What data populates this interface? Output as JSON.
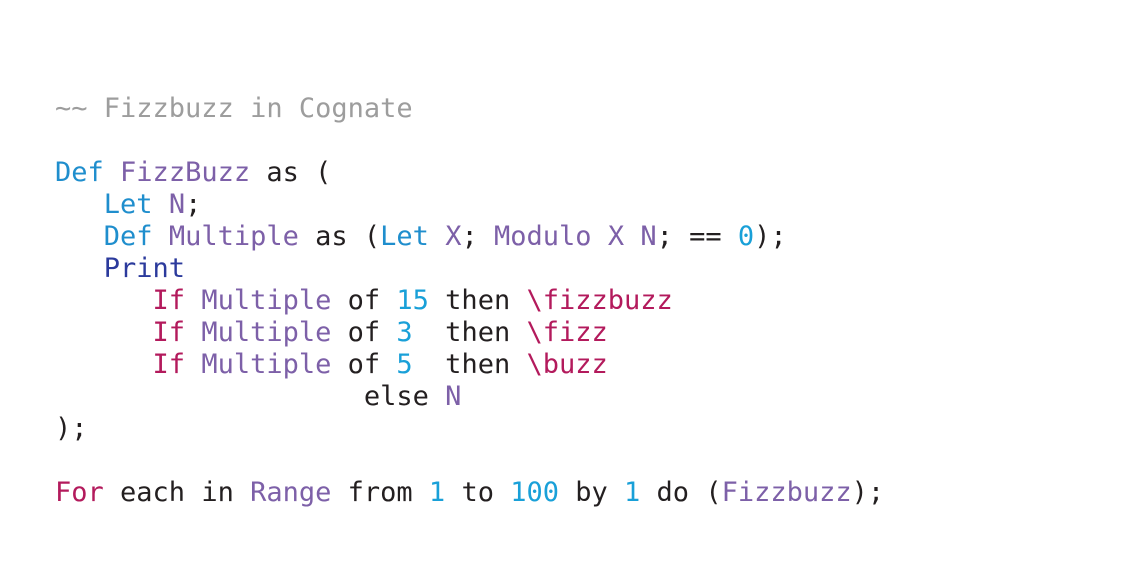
{
  "document": {
    "title": "Fizzbuzz in Cognate",
    "language": "Cognate",
    "background_color": "#ffffff"
  },
  "palette": {
    "comment": "#9d9d9d",
    "definition_keyword": "#1f8ecd",
    "print_keyword": "#2b3a9c",
    "identifier": "#7d60a8",
    "control_keyword": "#b31a5c",
    "number": "#19a0d8",
    "plain": "#231f20",
    "string": "#b31a5c"
  },
  "code": {
    "raw": "~~ Fizzbuzz in Cognate\n\nDef FizzBuzz as (\n   Let N;\n   Def Multiple as (Let X; Modulo X N; == 0);\n   Print\n      If Multiple of 15 then \\fizzbuzz\n      If Multiple of 3  then \\fizz\n      If Multiple of 5  then \\buzz\n                   else N\n);\n\nFor each in Range from 1 to 100 by 1 do (Fizzbuzz);",
    "lines": [
      {
        "id": "line-1-comment",
        "tokens": [
          {
            "text": "~~ Fizzbuzz in Cognate",
            "kind": "comment"
          }
        ]
      },
      {
        "id": "line-2-blank",
        "tokens": []
      },
      {
        "id": "line-3-def-fizzbuzz",
        "tokens": [
          {
            "text": "Def",
            "kind": "definition_keyword"
          },
          {
            "text": " ",
            "kind": "plain"
          },
          {
            "text": "FizzBuzz",
            "kind": "identifier"
          },
          {
            "text": " ",
            "kind": "plain"
          },
          {
            "text": "as",
            "kind": "plain"
          },
          {
            "text": " ",
            "kind": "plain"
          },
          {
            "text": "(",
            "kind": "plain"
          }
        ]
      },
      {
        "id": "line-4-let-n",
        "tokens": [
          {
            "text": "   ",
            "kind": "plain"
          },
          {
            "text": "Let",
            "kind": "definition_keyword"
          },
          {
            "text": " ",
            "kind": "plain"
          },
          {
            "text": "N",
            "kind": "identifier"
          },
          {
            "text": ";",
            "kind": "plain"
          }
        ]
      },
      {
        "id": "line-5-def-multiple",
        "tokens": [
          {
            "text": "   ",
            "kind": "plain"
          },
          {
            "text": "Def",
            "kind": "definition_keyword"
          },
          {
            "text": " ",
            "kind": "plain"
          },
          {
            "text": "Multiple",
            "kind": "identifier"
          },
          {
            "text": " ",
            "kind": "plain"
          },
          {
            "text": "as",
            "kind": "plain"
          },
          {
            "text": " (",
            "kind": "plain"
          },
          {
            "text": "Let",
            "kind": "definition_keyword"
          },
          {
            "text": " ",
            "kind": "plain"
          },
          {
            "text": "X",
            "kind": "identifier"
          },
          {
            "text": "; ",
            "kind": "plain"
          },
          {
            "text": "Modulo",
            "kind": "identifier"
          },
          {
            "text": " ",
            "kind": "plain"
          },
          {
            "text": "X",
            "kind": "identifier"
          },
          {
            "text": " ",
            "kind": "plain"
          },
          {
            "text": "N",
            "kind": "identifier"
          },
          {
            "text": "; == ",
            "kind": "plain"
          },
          {
            "text": "0",
            "kind": "number"
          },
          {
            "text": ");",
            "kind": "plain"
          }
        ]
      },
      {
        "id": "line-6-print",
        "tokens": [
          {
            "text": "   ",
            "kind": "plain"
          },
          {
            "text": "Print",
            "kind": "print_keyword"
          }
        ]
      },
      {
        "id": "line-7-if-15",
        "tokens": [
          {
            "text": "      ",
            "kind": "plain"
          },
          {
            "text": "If",
            "kind": "control_keyword"
          },
          {
            "text": " ",
            "kind": "plain"
          },
          {
            "text": "Multiple",
            "kind": "identifier"
          },
          {
            "text": " of ",
            "kind": "plain"
          },
          {
            "text": "15",
            "kind": "number"
          },
          {
            "text": " then ",
            "kind": "plain"
          },
          {
            "text": "\\fizzbuzz",
            "kind": "string"
          }
        ]
      },
      {
        "id": "line-8-if-3",
        "tokens": [
          {
            "text": "      ",
            "kind": "plain"
          },
          {
            "text": "If",
            "kind": "control_keyword"
          },
          {
            "text": " ",
            "kind": "plain"
          },
          {
            "text": "Multiple",
            "kind": "identifier"
          },
          {
            "text": " of ",
            "kind": "plain"
          },
          {
            "text": "3",
            "kind": "number"
          },
          {
            "text": "  then ",
            "kind": "plain"
          },
          {
            "text": "\\fizz",
            "kind": "string"
          }
        ]
      },
      {
        "id": "line-9-if-5",
        "tokens": [
          {
            "text": "      ",
            "kind": "plain"
          },
          {
            "text": "If",
            "kind": "control_keyword"
          },
          {
            "text": " ",
            "kind": "plain"
          },
          {
            "text": "Multiple",
            "kind": "identifier"
          },
          {
            "text": " of ",
            "kind": "plain"
          },
          {
            "text": "5",
            "kind": "number"
          },
          {
            "text": "  then ",
            "kind": "plain"
          },
          {
            "text": "\\buzz",
            "kind": "string"
          }
        ]
      },
      {
        "id": "line-10-else",
        "tokens": [
          {
            "text": "                   ",
            "kind": "plain"
          },
          {
            "text": "else",
            "kind": "plain"
          },
          {
            "text": " ",
            "kind": "plain"
          },
          {
            "text": "N",
            "kind": "identifier"
          }
        ]
      },
      {
        "id": "line-11-close",
        "tokens": [
          {
            "text": ");",
            "kind": "plain"
          }
        ]
      },
      {
        "id": "line-12-blank",
        "tokens": []
      },
      {
        "id": "line-13-for",
        "tokens": [
          {
            "text": "For",
            "kind": "control_keyword"
          },
          {
            "text": " each in ",
            "kind": "plain"
          },
          {
            "text": "Range",
            "kind": "identifier"
          },
          {
            "text": " from ",
            "kind": "plain"
          },
          {
            "text": "1",
            "kind": "number"
          },
          {
            "text": " to ",
            "kind": "plain"
          },
          {
            "text": "100",
            "kind": "number"
          },
          {
            "text": " by ",
            "kind": "plain"
          },
          {
            "text": "1",
            "kind": "number"
          },
          {
            "text": " do (",
            "kind": "plain"
          },
          {
            "text": "Fizzbuzz",
            "kind": "identifier"
          },
          {
            "text": ");",
            "kind": "plain"
          }
        ]
      }
    ]
  }
}
